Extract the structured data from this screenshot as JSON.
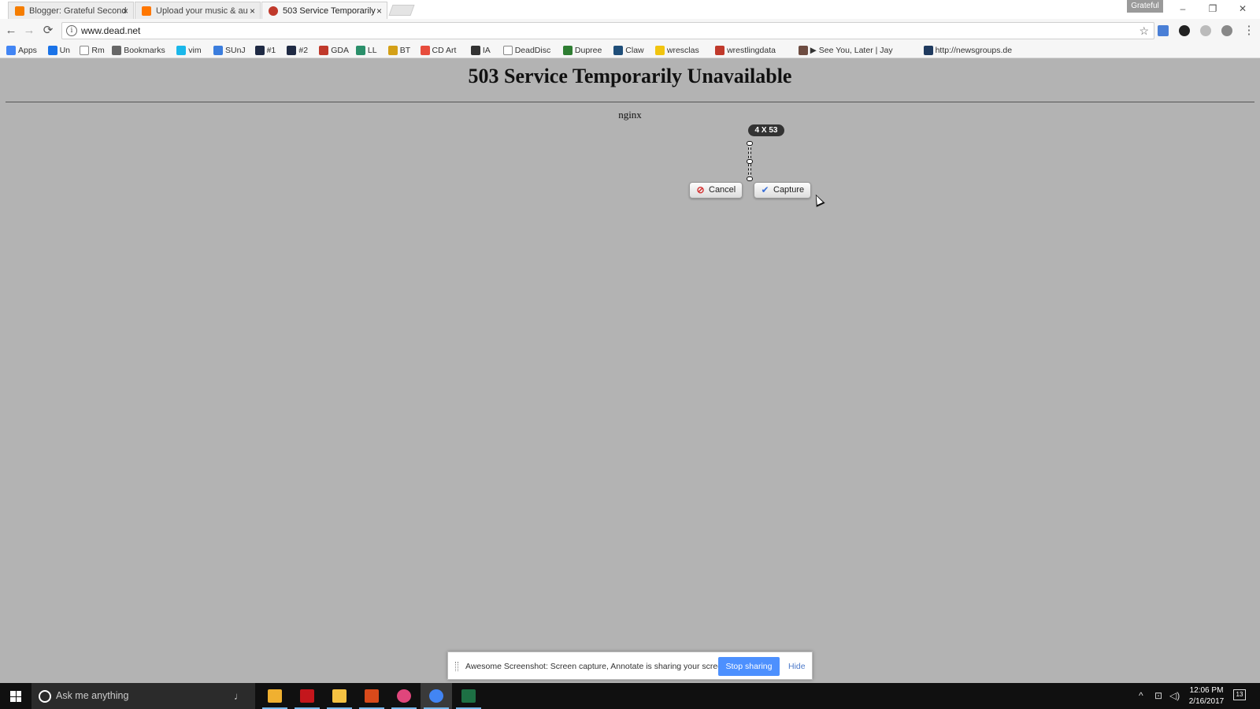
{
  "browser": {
    "tabs": [
      {
        "title": "Blogger: Grateful Second",
        "icon_color": "#f57d00",
        "active": false
      },
      {
        "title": "Upload your music & au",
        "icon_color": "#ff7700",
        "active": false
      },
      {
        "title": "503 Service Temporarily",
        "icon_color": "#c0392b",
        "active": true
      }
    ],
    "tab_close_glyph": "×",
    "profile_name": "Grateful",
    "window_controls": {
      "minimize": "–",
      "restore": "❐",
      "close": "✕"
    },
    "url": "www.dead.net",
    "info_glyph": "i",
    "bookmark_star": "☆",
    "back_glyph": "←",
    "forward_glyph": "→",
    "reload_glyph": "⟳",
    "menu_glyph": "⋮",
    "bookmarks": [
      {
        "label": "Apps",
        "icon": "apps-grid-icon",
        "color": "#4285f4"
      },
      {
        "label": "Un",
        "icon": "map-pin-icon",
        "color": "#1a73e8"
      },
      {
        "label": "Rm",
        "icon": "page-icon",
        "color": "#ffffff"
      },
      {
        "label": "Bookmarks",
        "icon": "star-icon",
        "color": "#666666"
      },
      {
        "label": "vim",
        "icon": "vimeo-icon",
        "color": "#1ab7ea"
      },
      {
        "label": "SUnJ",
        "icon": "g-icon",
        "color": "#3b7ddd"
      },
      {
        "label": "#1",
        "icon": "arrow-icon",
        "color": "#1f2a44"
      },
      {
        "label": "#2",
        "icon": "arrow-icon",
        "color": "#1f2a44"
      },
      {
        "label": "GDA",
        "icon": "gda-icon",
        "color": "#c0392b"
      },
      {
        "label": "LL",
        "icon": "ll-icon",
        "color": "#2a8f6a"
      },
      {
        "label": "BT",
        "icon": "bt-icon",
        "color": "#d4a017"
      },
      {
        "label": "CD Art",
        "icon": "cd-art-icon",
        "color": "#e74c3c"
      },
      {
        "label": "IA",
        "icon": "archive-icon",
        "color": "#333333"
      },
      {
        "label": "DeadDisc",
        "icon": "page-icon",
        "color": "#ffffff"
      },
      {
        "label": "Dupree",
        "icon": "dupree-icon",
        "color": "#2e7d32"
      },
      {
        "label": "Claw",
        "icon": "claw-icon",
        "color": "#1f4e79"
      },
      {
        "label": "wresclas",
        "icon": "bulb-icon",
        "color": "#f1c40f"
      },
      {
        "label": "wrestlingdata",
        "icon": "wrestlingdata-icon",
        "color": "#c0392b"
      },
      {
        "label": "▶ See You, Later | Jay",
        "icon": "jay-icon",
        "color": "#6d4c41"
      },
      {
        "label": "http://newsgroups.de",
        "icon": "dk-icon",
        "color": "#1f3a5f"
      }
    ]
  },
  "page": {
    "heading": "503 Service Temporarily Unavailable",
    "server": "nginx"
  },
  "capture": {
    "dimensions": "4 X 53",
    "cancel_label": "Cancel",
    "capture_label": "Capture",
    "cancel_glyph": "⃠",
    "capture_glyph": "✔"
  },
  "sharing": {
    "message": "Awesome Screenshot: Screen capture, Annotate is sharing your screen.",
    "stop_label": "Stop sharing",
    "hide_label": "Hide"
  },
  "taskbar": {
    "search_placeholder": "Ask me anything",
    "mic_glyph": "🎙",
    "apps": [
      {
        "name": "file-explorer-folder",
        "color": "#f0b030",
        "active": false
      },
      {
        "name": "acrobat",
        "color": "#c4161c",
        "active": false
      },
      {
        "name": "file-explorer",
        "color": "#f5c242",
        "active": false
      },
      {
        "name": "office-app",
        "color": "#d84a1b",
        "active": false
      },
      {
        "name": "itunes",
        "color": "#e0467c",
        "active": false
      },
      {
        "name": "chrome",
        "color": "#4285f4",
        "active": true
      },
      {
        "name": "excel",
        "color": "#1d7044",
        "active": false
      }
    ],
    "tray_glyphs": "^  ⊡  ◁)",
    "time": "12:06 PM",
    "date": "2/16/2017",
    "notification_count": "13"
  }
}
